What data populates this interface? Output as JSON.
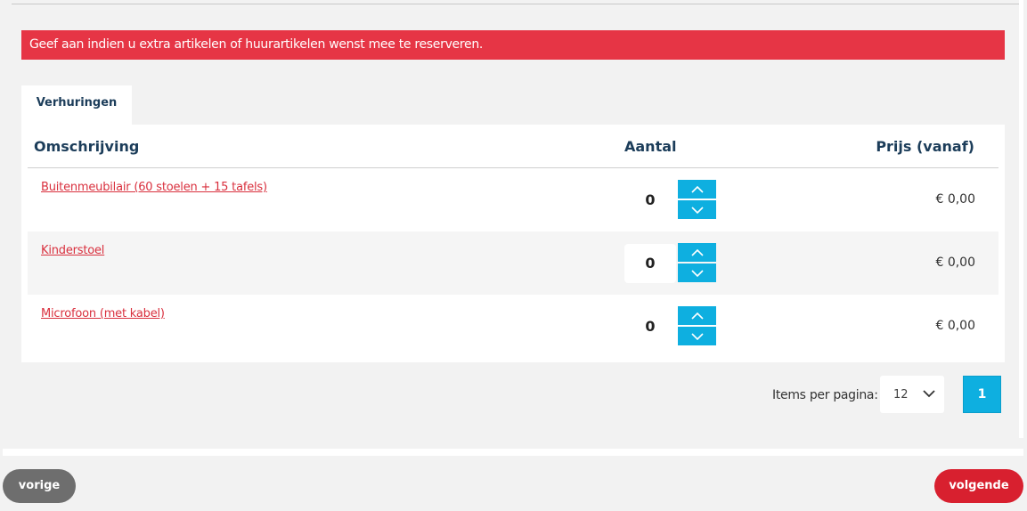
{
  "alert": {
    "text": "Geef aan indien u extra artikelen of huurartikelen wenst mee te reserveren."
  },
  "tabs": [
    {
      "label": "Verhuringen"
    }
  ],
  "table": {
    "headers": {
      "description": "Omschrijving",
      "quantity": "Aantal",
      "price": "Prijs (vanaf)"
    },
    "rows": [
      {
        "description": "Buitenmeubilair (60 stoelen + 15 tafels)",
        "quantity": "0",
        "price": "€ 0,00"
      },
      {
        "description": "Kinderstoel",
        "quantity": "0",
        "price": "€ 0,00"
      },
      {
        "description": "Microfoon (met kabel)",
        "quantity": "0",
        "price": "€ 0,00"
      }
    ]
  },
  "pagination": {
    "label": "Items per pagina:",
    "per_page": "12",
    "current_page": "1"
  },
  "nav": {
    "prev_label": "vorige",
    "next_label": "volgende"
  },
  "colors": {
    "alert": "#e63545",
    "accent": "#0eafe0",
    "link": "#d9303e",
    "next_button": "#d8202f",
    "prev_button": "#6e6e6e",
    "header_text": "#1c3d5a"
  },
  "icons": {
    "stepper_up": "chevron-up-icon",
    "stepper_down": "chevron-down-icon",
    "select": "chevron-down-icon"
  }
}
